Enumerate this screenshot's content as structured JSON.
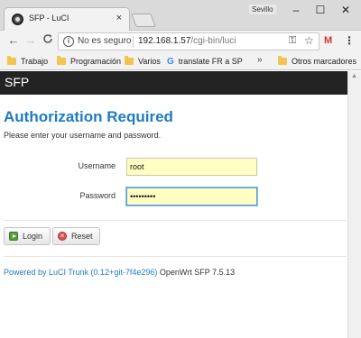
{
  "browser": {
    "tab_title": "SFP - LuCI",
    "tab_close": "×",
    "user_label": "Sevillo",
    "window_controls": {
      "minimize": "–",
      "maximize": "☐",
      "close": "✕"
    },
    "nav": {
      "back": "←",
      "forward": "→",
      "reload": "C"
    },
    "security_label": "No es seguro",
    "url_host": "192.168.1.57",
    "url_path": "/cgi-bin/luci",
    "gmail": "M",
    "menu": "⋮",
    "bookmarks": [
      "Trabajo",
      "Programación",
      "Varios",
      "translate FR a SP"
    ],
    "bookmarks_more": "»",
    "other_bookmarks": "Otros marcadores"
  },
  "page": {
    "brand": "SFP",
    "heading": "Authorization Required",
    "instructions": "Please enter your username and password.",
    "username_label": "Username",
    "username_value": "root",
    "password_label": "Password",
    "password_value": "•••••••••",
    "login_label": "Login",
    "reset_label": "Reset",
    "footer_link": "Powered by LuCI Trunk (0.12+git-7f4e296)",
    "footer_text": "OpenWrt SFP 7.5.13"
  }
}
